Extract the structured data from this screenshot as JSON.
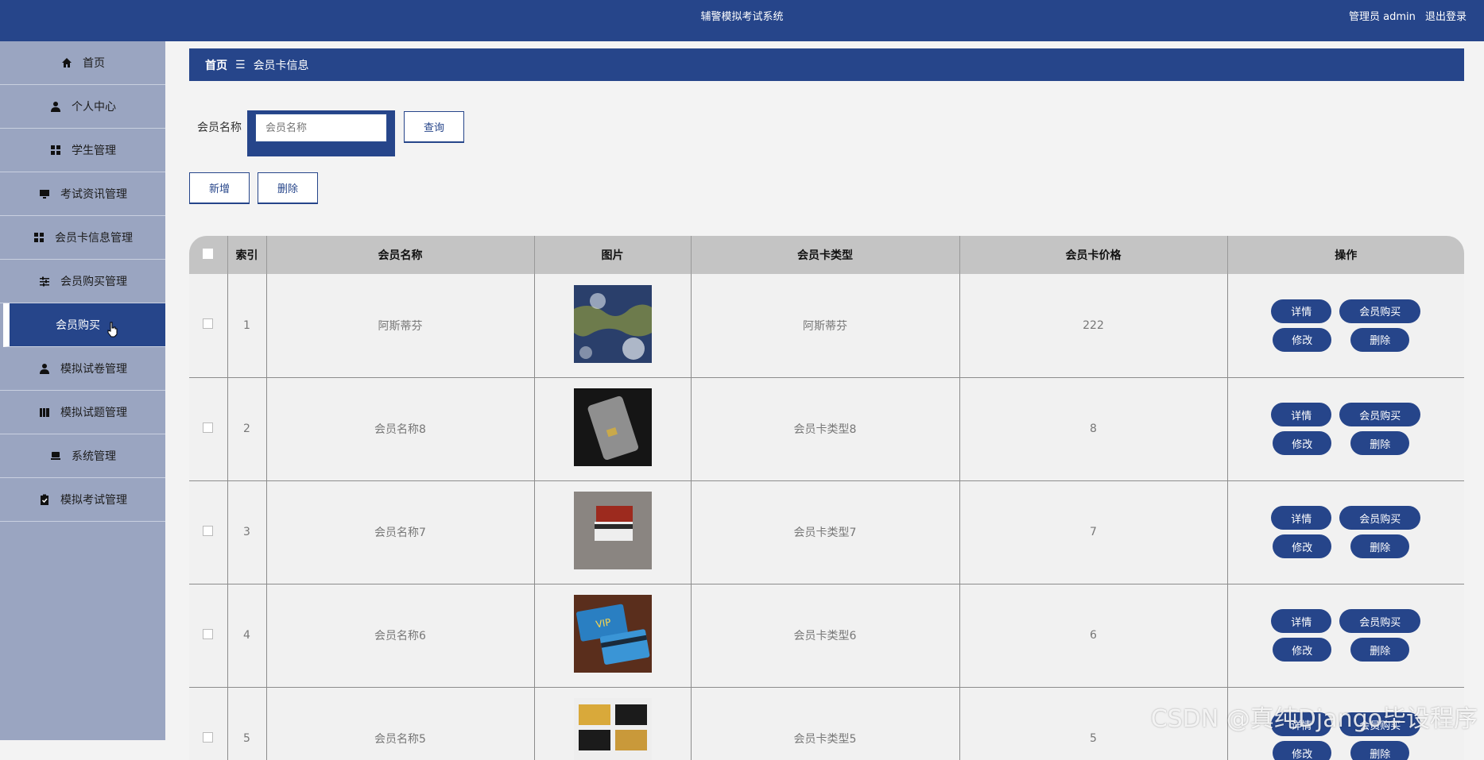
{
  "header": {
    "title": "辅警模拟考试系统",
    "user_label": "管理员 admin",
    "logout_label": "退出登录"
  },
  "sidebar": {
    "items": [
      {
        "label": "首页",
        "icon": "home-icon"
      },
      {
        "label": "个人中心",
        "icon": "user-icon"
      },
      {
        "label": "学生管理",
        "icon": "grid-icon"
      },
      {
        "label": "考试资讯管理",
        "icon": "monitor-icon"
      },
      {
        "label": "会员卡信息管理",
        "icon": "grid-icon"
      },
      {
        "label": "会员购买管理",
        "icon": "sliders-icon"
      },
      {
        "label": "会员购买",
        "icon": "",
        "active": true
      },
      {
        "label": "模拟试卷管理",
        "icon": "user-icon"
      },
      {
        "label": "模拟试题管理",
        "icon": "book-icon"
      },
      {
        "label": "系统管理",
        "icon": "computer-icon"
      },
      {
        "label": "模拟考试管理",
        "icon": "clipboard-check-icon"
      }
    ]
  },
  "breadcrumb": {
    "home": "首页",
    "separator": "☰",
    "current": "会员卡信息"
  },
  "search": {
    "label": "会员名称",
    "placeholder": "会员名称",
    "button": "查询"
  },
  "actions": {
    "add": "新增",
    "delete": "删除"
  },
  "table": {
    "columns": [
      "",
      "索引",
      "会员名称",
      "图片",
      "会员卡类型",
      "会员卡价格",
      "操作"
    ],
    "rows": [
      {
        "index": "1",
        "name": "阿斯蒂芬",
        "type": "阿斯蒂芬",
        "price": "222",
        "image": "satellite-map"
      },
      {
        "index": "2",
        "name": "会员名称8",
        "type": "会员卡类型8",
        "price": "8",
        "image": "dark-card"
      },
      {
        "index": "3",
        "name": "会员名称7",
        "type": "会员卡类型7",
        "price": "7",
        "image": "red-card"
      },
      {
        "index": "4",
        "name": "会员名称6",
        "type": "会员卡类型6",
        "price": "6",
        "image": "blue-vip-card"
      },
      {
        "index": "5",
        "name": "会员名称5",
        "type": "会员卡类型5",
        "price": "5",
        "image": "gold-black-cards"
      }
    ],
    "row_buttons": {
      "detail": "详情",
      "buy": "会员购买",
      "edit": "修改",
      "delete": "删除"
    }
  },
  "watermark": "CSDN @真纯Django毕设程序",
  "colors": {
    "primary": "#26458a",
    "sidebar": "#9aa5c1",
    "header_row": "#c4c4c4"
  }
}
